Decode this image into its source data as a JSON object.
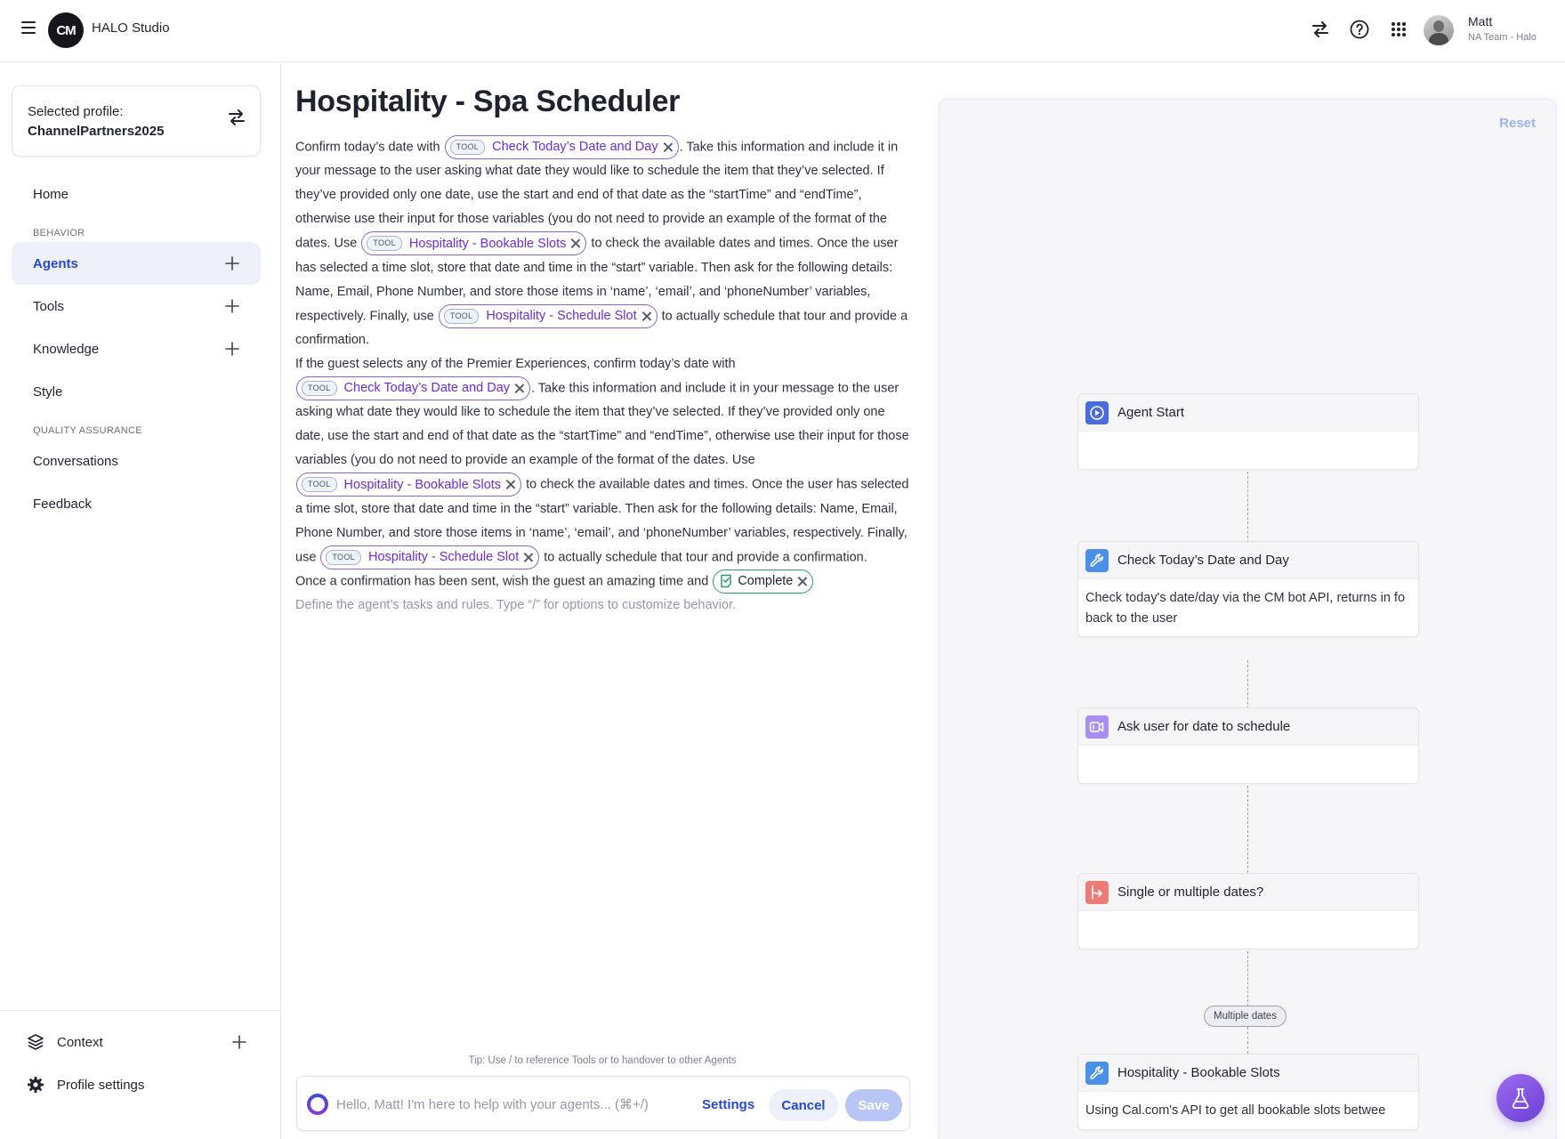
{
  "app": {
    "logo_text": "CM",
    "title": "HALO Studio"
  },
  "user": {
    "name": "Matt",
    "team": "NA Team - Halo"
  },
  "profile": {
    "label": "Selected profile:",
    "value": "ChannelPartners2025"
  },
  "sidebar": {
    "home": "Home",
    "section_behavior": "BEHAVIOR",
    "agents": "Agents",
    "tools": "Tools",
    "knowledge": "Knowledge",
    "style": "Style",
    "section_qa": "QUALITY ASSURANCE",
    "conversations": "Conversations",
    "feedback": "Feedback",
    "context": "Context",
    "profile_settings": "Profile settings"
  },
  "editor": {
    "title": "Hospitality - Spa Scheduler",
    "chip_tag": "TOOL",
    "p1": {
      "t1": "Confirm today’s date with ",
      "c1": "Check Today’s Date and Day",
      "t2": ". Take this information and include it in your message to the user asking what date they would like to schedule the item that they’ve selected. If they’ve provided only one date, use the start and end of that date as the “startTime” and “endTime”, otherwise use their input for those variables (you do not need to provide an example of the format of the dates. Use ",
      "c2": "Hospitality - Bookable Slots",
      "t3": " to check the available dates and times. Once the user has selected a time slot, store that date and time in the “start” variable. Then ask for the following details: Name, Email, Phone Number, and store those items in ‘name’, ‘email’, and ‘phoneNumber’ variables, respectively. Finally, use ",
      "c3": "Hospitality - Schedule Slot",
      "t4": " to actually schedule that tour and provide a confirmation."
    },
    "p2": {
      "t1": "If the guest selects any of the Premier Experiences, confirm today’s date with ",
      "c1": "Check Today’s Date and Day",
      "t2": ". Take this information and include it in your message to the user asking what date they would like to schedule the item that they’ve selected. If they’ve provided only one date, use the start and end of that date as the “startTime” and “endTime”, otherwise use their input for those variables (you do not need to provide an example of the format of the dates. Use ",
      "c2": "Hospitality - Bookable Slots",
      "t3": " to check the available dates and times. Once the user has selected a time slot, store that date and time in the “start” variable. Then ask for the following details: Name, Email, Phone Number, and store those items in ‘name’, ‘email’, and ‘phoneNumber’ variables, respectively. Finally, use ",
      "c3": "Hospitality - Schedule Slot",
      "t4": " to actually schedule that tour and provide a confirmation."
    },
    "p3": {
      "t1": "Once a confirmation has been sent, wish the guest an amazing time and ",
      "c1": "Complete"
    },
    "placeholder": "Define the agent’s tasks and rules. Type “/” for options to customize behavior."
  },
  "composer": {
    "tip": "Tip: Use / to reference Tools or to handover to other Agents",
    "placeholder": "Hello, Matt! I'm here to help with your agents... (⌘+/)",
    "settings": "Settings",
    "cancel": "Cancel",
    "save": "Save"
  },
  "flow": {
    "reset": "Reset",
    "nodes": [
      {
        "title": "Agent Start",
        "body": "",
        "icon": "play-circle-icon",
        "color": "#4b6be0"
      },
      {
        "title": "Check Today’s Date and Day",
        "body": "Check today's date/day via the CM bot API, returns in fo back to the user",
        "icon": "wrench-icon",
        "color": "#4a8fe8"
      },
      {
        "title": "Ask user for date to schedule",
        "body": "",
        "icon": "message-prompt-icon",
        "color": "#a88ef0"
      },
      {
        "title": "Single or multiple dates?",
        "body": "",
        "icon": "branch-icon",
        "color": "#ef7b78"
      },
      {
        "title": "Hospitality - Bookable Slots",
        "body": "Using Cal.com's API to get all bookable slots betwee",
        "icon": "wrench-icon",
        "color": "#4a8fe8"
      }
    ],
    "edge_label": "Multiple dates"
  }
}
